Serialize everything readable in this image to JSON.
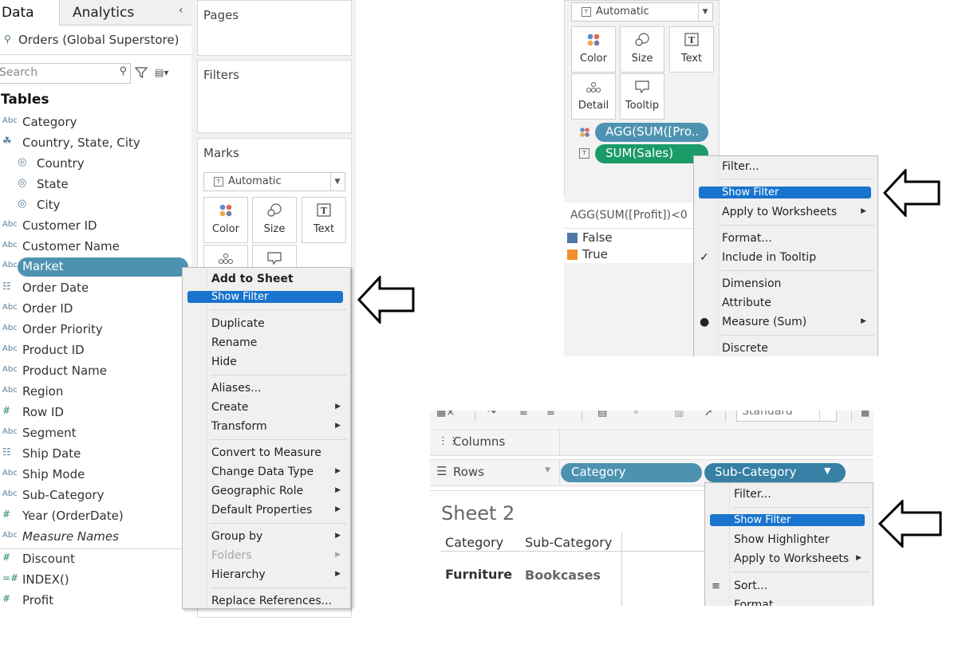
{
  "data_pane": {
    "tab_data": "Data",
    "tab_analytics": "Analytics",
    "datasource": "Orders (Global Superstore)",
    "search_placeholder": "Search",
    "tables_heading": "Tables",
    "fields": [
      {
        "type": "Abc",
        "label": "Category"
      },
      {
        "type": "hier",
        "label": "Country, State, City"
      },
      {
        "type": "geo",
        "label": "Country"
      },
      {
        "type": "geo",
        "label": "State"
      },
      {
        "type": "geo",
        "label": "City"
      },
      {
        "type": "Abc",
        "label": "Customer ID"
      },
      {
        "type": "Abc",
        "label": "Customer Name"
      },
      {
        "type": "Abc",
        "label": "Market"
      },
      {
        "type": "date",
        "label": "Order Date"
      },
      {
        "type": "Abc",
        "label": "Order ID"
      },
      {
        "type": "Abc",
        "label": "Order Priority"
      },
      {
        "type": "Abc",
        "label": "Product ID"
      },
      {
        "type": "Abc",
        "label": "Product Name"
      },
      {
        "type": "Abc",
        "label": "Region"
      },
      {
        "type": "#",
        "label": "Row ID"
      },
      {
        "type": "Abc",
        "label": "Segment"
      },
      {
        "type": "date",
        "label": "Ship Date"
      },
      {
        "type": "Abc",
        "label": "Ship Mode"
      },
      {
        "type": "Abc",
        "label": "Sub-Category"
      },
      {
        "type": "#",
        "label": "Year (OrderDate)"
      },
      {
        "type": "Abc",
        "label": "Measure Names"
      },
      {
        "type": "#",
        "label": "Discount"
      },
      {
        "type": "=#",
        "label": "INDEX()"
      },
      {
        "type": "#",
        "label": "Profit"
      }
    ]
  },
  "cards": {
    "pages": "Pages",
    "filters": "Filters",
    "marks": "Marks",
    "mark_type": "Automatic",
    "color": "Color",
    "size": "Size",
    "text": "Text",
    "detail": "Detail",
    "tooltip": "Tooltip"
  },
  "menu_market": {
    "items": [
      "Add to Sheet",
      "Show Filter",
      "Duplicate",
      "Rename",
      "Hide",
      "Aliases...",
      "Create",
      "Transform",
      "Convert to Measure",
      "Change Data Type",
      "Geographic Role",
      "Default Properties",
      "Group by",
      "Folders",
      "Hierarchy",
      "Replace References..."
    ]
  },
  "inset_marks": {
    "mark_type": "Automatic",
    "color": "Color",
    "size": "Size",
    "text": "Text",
    "detail": "Detail",
    "tooltip": "Tooltip",
    "pill_profit": "AGG(SUM([Pro..",
    "pill_sales": "SUM(Sales)",
    "legend_title": "AGG(SUM([Profit])<0",
    "legend_items": [
      {
        "label": "False",
        "color": "#4e79a7"
      },
      {
        "label": "True",
        "color": "#f28e2b"
      }
    ],
    "menu": [
      "Filter...",
      "Show Filter",
      "Apply to Worksheets",
      "Format...",
      "Include in Tooltip",
      "Dimension",
      "Attribute",
      "Measure (Sum)",
      "Discrete"
    ]
  },
  "inset_sheet": {
    "toolbar_fit": "Standard",
    "columns": "Columns",
    "rows": "Rows",
    "pill_category": "Category",
    "pill_subcategory": "Sub-Category",
    "sheet_title": "Sheet 2",
    "col_header_1": "Category",
    "col_header_2": "Sub-Category",
    "row_category": "Furniture",
    "row_subcategory": "Bookcases",
    "menu": [
      "Filter...",
      "Show Filter",
      "Show Highlighter",
      "Apply to Worksheets",
      "Sort...",
      "Format..."
    ]
  },
  "colors": {
    "dimension_pill": "#4d93b1",
    "measure_pill": "#1a9b68",
    "highlight": "#1874cd"
  }
}
